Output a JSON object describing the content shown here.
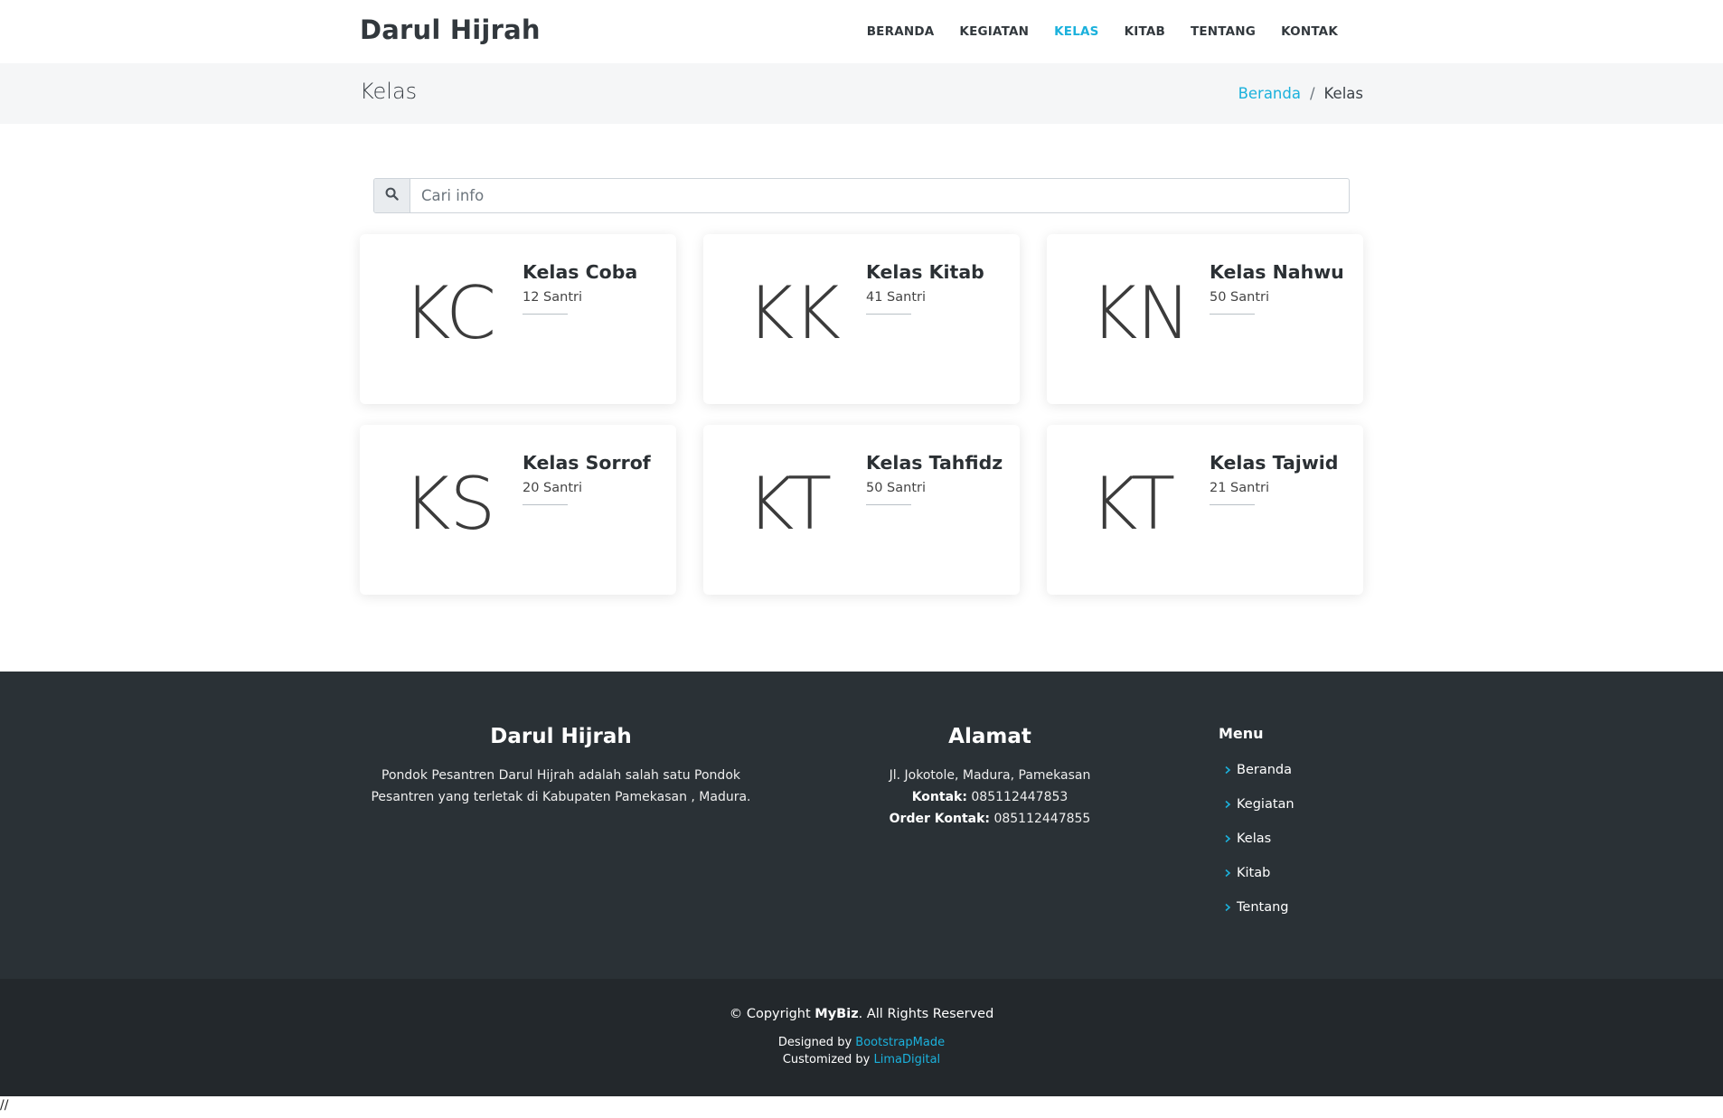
{
  "header": {
    "logo": "Darul Hijrah",
    "nav": [
      {
        "label": "BERANDA",
        "active": false
      },
      {
        "label": "KEGIATAN",
        "active": false
      },
      {
        "label": "KELAS",
        "active": true
      },
      {
        "label": "KITAB",
        "active": false
      },
      {
        "label": "TENTANG",
        "active": false
      },
      {
        "label": "KONTAK",
        "active": false
      }
    ]
  },
  "breadcrumbs": {
    "title": "Kelas",
    "items": [
      "Beranda",
      "/",
      "Kelas"
    ]
  },
  "search": {
    "icon": "search-icon",
    "placeholder": "Cari info"
  },
  "cards": [
    {
      "initials": "KC",
      "title": "Kelas Coba",
      "count": "12 Santri"
    },
    {
      "initials": "KK",
      "title": "Kelas Kitab",
      "count": "41 Santri"
    },
    {
      "initials": "KN",
      "title": "Kelas Nahwu",
      "count": "50 Santri"
    },
    {
      "initials": "KS",
      "title": "Kelas Sorrof",
      "count": "20 Santri"
    },
    {
      "initials": "KT",
      "title": "Kelas Tahfidz",
      "count": "50 Santri"
    },
    {
      "initials": "KT",
      "title": "Kelas Tajwid",
      "count": "21 Santri"
    }
  ],
  "footer": {
    "about": {
      "title": "Darul Hijrah",
      "text": "Pondok Pesantren Darul Hijrah adalah salah satu Pondok Pesantren yang terletak di Kabupaten Pamekasan , Madura."
    },
    "address": {
      "title": "Alamat",
      "street": "Jl. Jokotole, Madura, Pamekasan",
      "contact_label": "Kontak:",
      "contact_value": " 085112447853",
      "order_label": "Order Kontak:",
      "order_value": " 085112447855"
    },
    "menu": {
      "title": "Menu",
      "items": [
        "Beranda",
        "Kegiatan",
        "Kelas",
        "Kitab",
        "Tentang"
      ]
    },
    "copyright": {
      "prefix": "© Copyright ",
      "brand": "MyBiz",
      "suffix": ". All Rights Reserved"
    },
    "designed_prefix": "Designed by ",
    "designed_link": "BootstrapMade",
    "customized_prefix": "Customized by ",
    "customized_link": "LimaDigital"
  },
  "stray_text": "//",
  "colors": {
    "accent": "#1bb1dc",
    "footer_top": "#2a3136",
    "footer_bottom": "#23282c"
  }
}
